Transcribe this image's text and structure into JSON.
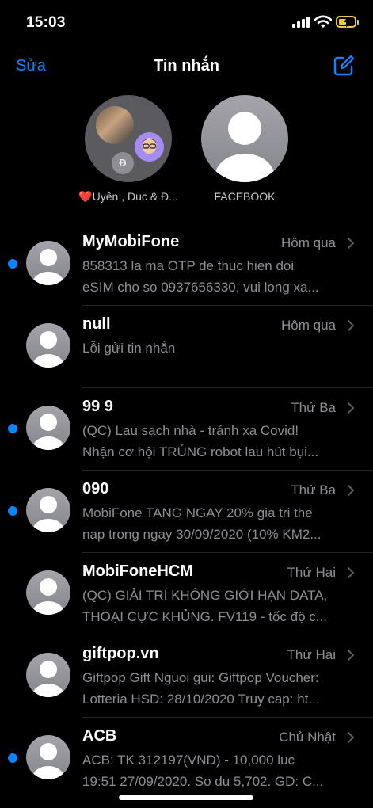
{
  "status_bar": {
    "time": "15:03"
  },
  "nav": {
    "edit_label": "Sửa",
    "title": "Tin nhắn"
  },
  "pinned": [
    {
      "label": "❤️Uyên , Duc & Đ...",
      "initial": "Đ"
    },
    {
      "label": "FACEBOOK"
    }
  ],
  "messages": [
    {
      "name": "MyMobiFone",
      "date": "Hôm qua",
      "unread": true,
      "lines": [
        "858313 la ma OTP de thuc hien doi",
        "eSIM cho so 0937656330, vui long xa..."
      ]
    },
    {
      "name": "null",
      "date": "Hôm qua",
      "unread": false,
      "lines": [
        "Lỗi gửi tin nhắn",
        ""
      ]
    },
    {
      "name": "99 9",
      "date": "Thứ Ba",
      "unread": true,
      "lines": [
        "(QC) Lau sạch nhà - tránh xa Covid!",
        "Nhận cơ hội TRÚNG robot lau hút bụi..."
      ]
    },
    {
      "name": "090",
      "date": "Thứ Ba",
      "unread": true,
      "lines": [
        "MobiFone TANG NGAY 20% gia tri the",
        "nap trong ngay 30/09/2020 (10% KM2..."
      ]
    },
    {
      "name": "MobiFoneHCM",
      "date": "Thứ Hai",
      "unread": false,
      "lines": [
        "(QC) GIẢI TRÍ KHÔNG GIỚI HẠN DATA,",
        "THOẠI CỰC KHỦNG. FV119 - tốc độ c..."
      ]
    },
    {
      "name": "giftpop.vn",
      "date": "Thứ Hai",
      "unread": false,
      "lines": [
        "Giftpop Gift Nguoi gui: Giftpop Voucher:",
        "Lotteria  HSD: 28/10/2020 Truy cap: ht..."
      ]
    },
    {
      "name": "ACB",
      "date": "Chủ Nhật",
      "unread": true,
      "lines": [
        "ACB: TK 312197(VND) - 10,000 luc",
        "19:51 27/09/2020. So du 5,702. GD: C..."
      ]
    }
  ],
  "icons": {
    "compose": "square-and-pencil-icon",
    "chevron": "chevron-right-icon",
    "avatar": "person-silhouette-icon"
  },
  "colors": {
    "accent": "#0a84ff",
    "background": "#000000",
    "secondary_text": "#8e8e93",
    "battery": "#f0cc3a"
  }
}
